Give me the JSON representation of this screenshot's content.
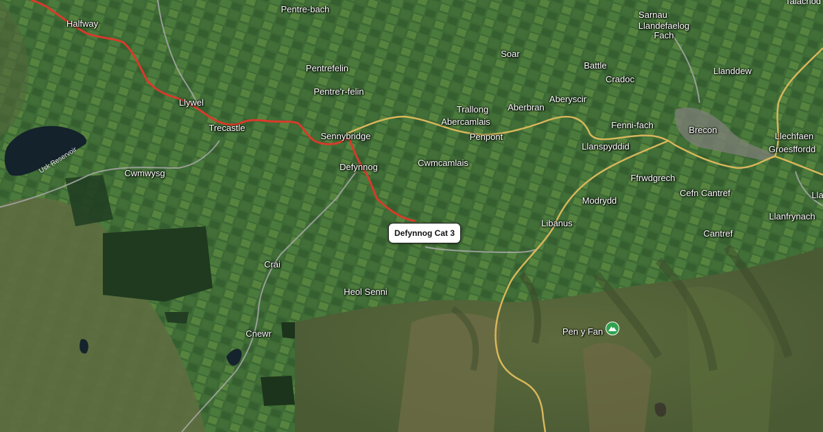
{
  "map": {
    "segment_label": "Defynnog Cat 3",
    "peak": {
      "name": "Pen y Fan",
      "icon": "mountain-peak-icon",
      "color": "#2fa24f"
    },
    "reservoir": "Usk Reservoir",
    "top_right_fragment": "Talachod",
    "route_color": "#d93a2b",
    "road_yellow": "#d8b75a",
    "road_grey": "#a9a9a9",
    "places": [
      {
        "id": "halfway",
        "name": "Halfway"
      },
      {
        "id": "pentre-bach",
        "name": "Pentre-bach"
      },
      {
        "id": "sarnau",
        "name": "Sarnau"
      },
      {
        "id": "llandefaelog-fach",
        "name": "Llandefaelog\nFach"
      },
      {
        "id": "soar",
        "name": "Soar"
      },
      {
        "id": "battle",
        "name": "Battle"
      },
      {
        "id": "llanddew",
        "name": "Llanddew"
      },
      {
        "id": "pentrefelin",
        "name": "Pentrefelin"
      },
      {
        "id": "cradoc",
        "name": "Cradoc"
      },
      {
        "id": "llywel",
        "name": "Llywel"
      },
      {
        "id": "pentre-r-felin",
        "name": "Pentre'r-felin"
      },
      {
        "id": "trallong",
        "name": "Trallong"
      },
      {
        "id": "aberbran",
        "name": "Aberbran"
      },
      {
        "id": "aberyscir",
        "name": "Aberyscir"
      },
      {
        "id": "abercamlais",
        "name": "Abercamlais"
      },
      {
        "id": "trecastle",
        "name": "Trecastle"
      },
      {
        "id": "fenni-fach",
        "name": "Fenni-fach"
      },
      {
        "id": "brecon",
        "name": "Brecon"
      },
      {
        "id": "llechfaen",
        "name": "Llechfaen"
      },
      {
        "id": "sennybridge",
        "name": "Sennybridge"
      },
      {
        "id": "penpont",
        "name": "Penpont"
      },
      {
        "id": "llanspyddid",
        "name": "Llanspyddid"
      },
      {
        "id": "groesffordd",
        "name": "Groesffordd"
      },
      {
        "id": "cwmcamlais",
        "name": "Cwmcamlais"
      },
      {
        "id": "defynnog",
        "name": "Defynnog"
      },
      {
        "id": "cwmwysg",
        "name": "Cwmwysg"
      },
      {
        "id": "ffrwdgrech",
        "name": "Ffrwdgrech"
      },
      {
        "id": "cefn-cantref",
        "name": "Cefn Cantref"
      },
      {
        "id": "modrydd",
        "name": "Modrydd"
      },
      {
        "id": "llanfrynach",
        "name": "Llanfrynach"
      },
      {
        "id": "libanus",
        "name": "Libanus"
      },
      {
        "id": "cantref",
        "name": "Cantref"
      },
      {
        "id": "crai",
        "name": "Crai"
      },
      {
        "id": "heol-senni",
        "name": "Heol Senni"
      },
      {
        "id": "cnewr",
        "name": "Cnewr"
      },
      {
        "id": "lla-fragment",
        "name": "Lla"
      }
    ]
  }
}
